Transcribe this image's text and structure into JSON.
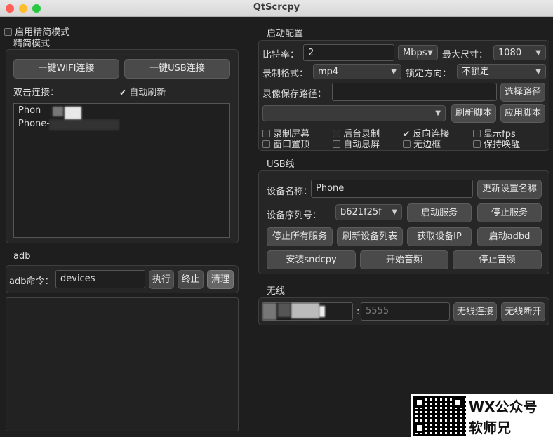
{
  "window": {
    "title": "QtScrcpy"
  },
  "simple_mode": {
    "enable_label": "启用精简模式",
    "group_title": "精简模式",
    "wifi_button": "一键WIFI连接",
    "usb_button": "一键USB连接",
    "double_click_label": "双击连接：",
    "auto_refresh_label": "自动刷新",
    "devices": [
      "Phon",
      "Phone-"
    ]
  },
  "adb": {
    "group_title": "adb",
    "command_label": "adb命令：",
    "command_value": "devices",
    "execute_button": "执行",
    "stop_button": "终止",
    "clear_button": "清理"
  },
  "launch_config": {
    "group_title": "启动配置",
    "bitrate_label": "比特率：",
    "bitrate_value": "2",
    "bitrate_unit": "Mbps",
    "max_size_label": "最大尺寸：",
    "max_size_value": "1080",
    "record_format_label": "录制格式：",
    "record_format_value": "mp4",
    "lock_orientation_label": "锁定方向：",
    "lock_orientation_value": "不锁定",
    "record_path_label": "录像保存路径：",
    "record_path_value": "",
    "select_path_button": "选择路径",
    "script_value": "",
    "refresh_script_button": "刷新脚本",
    "apply_script_button": "应用脚本",
    "options": {
      "record_screen": "录制屏幕",
      "background_record": "后台录制",
      "reverse_connection": "反向连接",
      "show_fps": "显示fps",
      "window_on_top": "窗口置顶",
      "auto_screen_off": "自动息屏",
      "frameless": "无边框",
      "stay_awake": "保持唤醒"
    }
  },
  "usb": {
    "group_title": "USB线",
    "device_name_label": "设备名称：",
    "device_name_value": "Phone",
    "update_name_button": "更新设置名称",
    "serial_label": "设备序列号：",
    "serial_value": "b621f25f",
    "start_service_button": "启动服务",
    "stop_service_button": "停止服务",
    "stop_all_button": "停止所有服务",
    "refresh_devices_button": "刷新设备列表",
    "get_ip_button": "获取设备IP",
    "start_adbd_button": "启动adbd",
    "install_sndcpy_button": "安装sndcpy",
    "start_audio_button": "开始音频",
    "stop_audio_button": "停止音频"
  },
  "wireless": {
    "group_title": "无线",
    "ip_value": "",
    "port_separator": ":",
    "port_placeholder": "5555",
    "connect_button": "无线连接",
    "disconnect_button": "无线断开"
  },
  "watermark": {
    "line1": "WX公众号",
    "line2": "软师兄"
  },
  "colors": {
    "close": "#fe5f57",
    "minimize": "#febc2e",
    "zoom": "#28c840"
  }
}
